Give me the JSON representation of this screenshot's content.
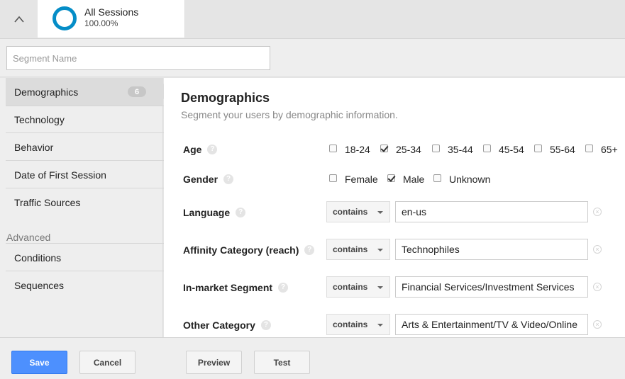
{
  "segment": {
    "name": "All Sessions",
    "percent": "100.00%",
    "ring_color": "#058dc7"
  },
  "name_input": {
    "placeholder": "Segment Name",
    "value": ""
  },
  "sidebar": {
    "items": [
      {
        "label": "Demographics",
        "badge": "6",
        "active": true
      },
      {
        "label": "Technology"
      },
      {
        "label": "Behavior"
      },
      {
        "label": "Date of First Session"
      },
      {
        "label": "Traffic Sources"
      }
    ],
    "advanced_heading": "Advanced",
    "advanced_items": [
      {
        "label": "Conditions"
      },
      {
        "label": "Sequences"
      }
    ]
  },
  "main": {
    "title": "Demographics",
    "subtitle": "Segment your users by demographic information.",
    "help_glyph": "?",
    "age": {
      "label": "Age",
      "options": [
        {
          "label": "18-24",
          "checked": false
        },
        {
          "label": "25-34",
          "checked": true
        },
        {
          "label": "35-44",
          "checked": false
        },
        {
          "label": "45-54",
          "checked": false
        },
        {
          "label": "55-64",
          "checked": false
        },
        {
          "label": "65+",
          "checked": false
        }
      ]
    },
    "gender": {
      "label": "Gender",
      "options": [
        {
          "label": "Female",
          "checked": false
        },
        {
          "label": "Male",
          "checked": true
        },
        {
          "label": "Unknown",
          "checked": false
        }
      ]
    },
    "filters": [
      {
        "label": "Language",
        "operator": "contains",
        "value": "en-us"
      },
      {
        "label": "Affinity Category (reach)",
        "operator": "contains",
        "value": "Technophiles"
      },
      {
        "label": "In-market Segment",
        "operator": "contains",
        "value": "Financial Services/Investment Services"
      },
      {
        "label": "Other Category",
        "operator": "contains",
        "value": "Arts & Entertainment/TV & Video/Online"
      }
    ]
  },
  "footer": {
    "save": "Save",
    "cancel": "Cancel",
    "preview": "Preview",
    "test": "Test"
  },
  "colors": {
    "primary": "#4d90fe",
    "ring": "#058dc7"
  }
}
